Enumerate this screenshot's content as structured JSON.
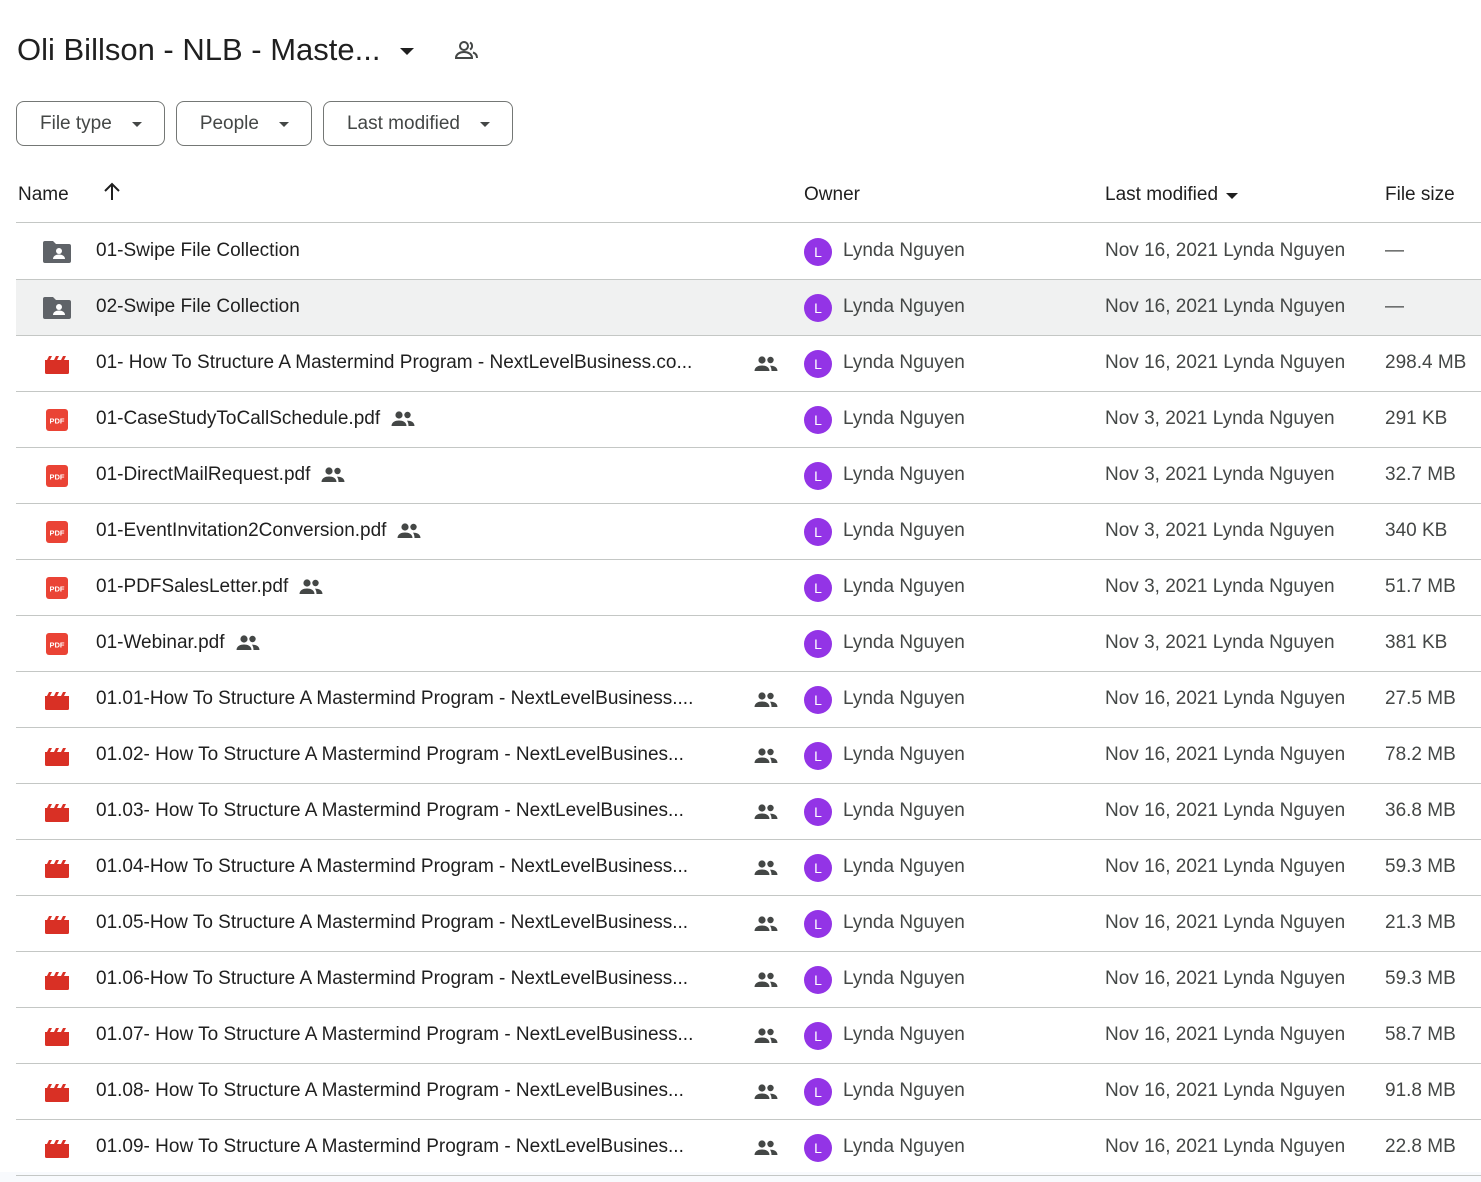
{
  "folder": {
    "title": "Oli Billson - NLB - Maste...",
    "title_dropdown_icon": "arrow-drop-down-icon",
    "shared_icon": "people-outline-icon"
  },
  "filters": [
    {
      "label": "File type"
    },
    {
      "label": "People"
    },
    {
      "label": "Last modified"
    }
  ],
  "columns": {
    "name": "Name",
    "owner": "Owner",
    "last_modified": "Last modified",
    "file_size": "File size",
    "sort_icon": "arrow-upward-icon"
  },
  "colors": {
    "avatar": "#9334e6",
    "video_icon": "#d93025",
    "pdf_icon": "#ea4335",
    "folder_icon": "#5f6368",
    "selected_row": "#f0f1f1"
  },
  "files": [
    {
      "type": "shared-folder",
      "icon": "shared-folder-icon",
      "name": "01-Swipe File Collection",
      "shared": false,
      "owner_initial": "L",
      "owner": "Lynda Nguyen",
      "modified": "Nov 16, 2021 Lynda Nguyen",
      "size": "—"
    },
    {
      "type": "shared-folder",
      "icon": "shared-folder-icon",
      "name": "02-Swipe File Collection",
      "shared": false,
      "owner_initial": "L",
      "owner": "Lynda Nguyen",
      "modified": "Nov 16, 2021 Lynda Nguyen",
      "size": "—",
      "selected": true
    },
    {
      "type": "video",
      "icon": "video-file-icon",
      "name": "01- How To Structure A Mastermind Program - NextLevelBusiness.co...",
      "shared": true,
      "owner_initial": "L",
      "owner": "Lynda Nguyen",
      "modified": "Nov 16, 2021 Lynda Nguyen",
      "size": "298.4 MB"
    },
    {
      "type": "pdf",
      "icon": "pdf-file-icon",
      "name": "01-CaseStudyToCallSchedule.pdf",
      "shared": true,
      "owner_initial": "L",
      "owner": "Lynda Nguyen",
      "modified": "Nov 3, 2021 Lynda Nguyen",
      "size": "291 KB"
    },
    {
      "type": "pdf",
      "icon": "pdf-file-icon",
      "name": "01-DirectMailRequest.pdf",
      "shared": true,
      "owner_initial": "L",
      "owner": "Lynda Nguyen",
      "modified": "Nov 3, 2021 Lynda Nguyen",
      "size": "32.7 MB"
    },
    {
      "type": "pdf",
      "icon": "pdf-file-icon",
      "name": "01-EventInvitation2Conversion.pdf",
      "shared": true,
      "owner_initial": "L",
      "owner": "Lynda Nguyen",
      "modified": "Nov 3, 2021 Lynda Nguyen",
      "size": "340 KB"
    },
    {
      "type": "pdf",
      "icon": "pdf-file-icon",
      "name": "01-PDFSalesLetter.pdf",
      "shared": true,
      "owner_initial": "L",
      "owner": "Lynda Nguyen",
      "modified": "Nov 3, 2021 Lynda Nguyen",
      "size": "51.7 MB"
    },
    {
      "type": "pdf",
      "icon": "pdf-file-icon",
      "name": "01-Webinar.pdf",
      "shared": true,
      "owner_initial": "L",
      "owner": "Lynda Nguyen",
      "modified": "Nov 3, 2021 Lynda Nguyen",
      "size": "381 KB"
    },
    {
      "type": "video",
      "icon": "video-file-icon",
      "name": "01.01-How To Structure A Mastermind Program - NextLevelBusiness....",
      "shared": true,
      "owner_initial": "L",
      "owner": "Lynda Nguyen",
      "modified": "Nov 16, 2021 Lynda Nguyen",
      "size": "27.5 MB"
    },
    {
      "type": "video",
      "icon": "video-file-icon",
      "name": "01.02- How To Structure A Mastermind Program - NextLevelBusines...",
      "shared": true,
      "owner_initial": "L",
      "owner": "Lynda Nguyen",
      "modified": "Nov 16, 2021 Lynda Nguyen",
      "size": "78.2 MB"
    },
    {
      "type": "video",
      "icon": "video-file-icon",
      "name": "01.03- How To Structure A Mastermind Program - NextLevelBusines...",
      "shared": true,
      "owner_initial": "L",
      "owner": "Lynda Nguyen",
      "modified": "Nov 16, 2021 Lynda Nguyen",
      "size": "36.8 MB"
    },
    {
      "type": "video",
      "icon": "video-file-icon",
      "name": "01.04-How To Structure A Mastermind Program - NextLevelBusiness...",
      "shared": true,
      "owner_initial": "L",
      "owner": "Lynda Nguyen",
      "modified": "Nov 16, 2021 Lynda Nguyen",
      "size": "59.3 MB"
    },
    {
      "type": "video",
      "icon": "video-file-icon",
      "name": "01.05-How To Structure A Mastermind Program - NextLevelBusiness...",
      "shared": true,
      "owner_initial": "L",
      "owner": "Lynda Nguyen",
      "modified": "Nov 16, 2021 Lynda Nguyen",
      "size": "21.3 MB"
    },
    {
      "type": "video",
      "icon": "video-file-icon",
      "name": "01.06-How To Structure A Mastermind Program - NextLevelBusiness...",
      "shared": true,
      "owner_initial": "L",
      "owner": "Lynda Nguyen",
      "modified": "Nov 16, 2021 Lynda Nguyen",
      "size": "59.3 MB"
    },
    {
      "type": "video",
      "icon": "video-file-icon",
      "name": "01.07- How To Structure A Mastermind Program - NextLevelBusiness...",
      "shared": true,
      "owner_initial": "L",
      "owner": "Lynda Nguyen",
      "modified": "Nov 16, 2021 Lynda Nguyen",
      "size": "58.7 MB"
    },
    {
      "type": "video",
      "icon": "video-file-icon",
      "name": "01.08- How To Structure A Mastermind Program - NextLevelBusines...",
      "shared": true,
      "owner_initial": "L",
      "owner": "Lynda Nguyen",
      "modified": "Nov 16, 2021 Lynda Nguyen",
      "size": "91.8 MB"
    },
    {
      "type": "video",
      "icon": "video-file-icon",
      "name": "01.09- How To Structure A Mastermind Program - NextLevelBusines...",
      "shared": true,
      "owner_initial": "L",
      "owner": "Lynda Nguyen",
      "modified": "Nov 16, 2021 Lynda Nguyen",
      "size": "22.8 MB"
    }
  ]
}
